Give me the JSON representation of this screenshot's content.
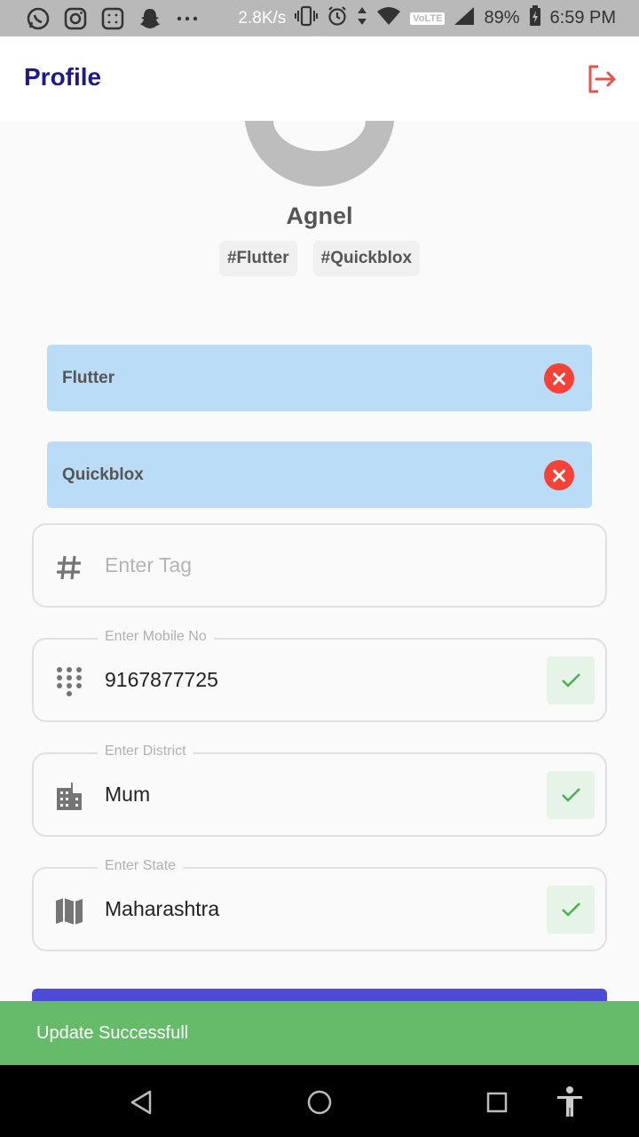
{
  "status_bar": {
    "speed": "2.8K/s",
    "network": "VoLTE",
    "battery": "89%",
    "time": "6:59 PM",
    "icons": [
      "whatsapp-icon",
      "instagram-icon",
      "calculator-icon",
      "snapchat-icon",
      "more-dots-icon",
      "vibrate-icon",
      "alarm-icon",
      "data-arrows-icon",
      "wifi-icon",
      "signal-icon",
      "battery-icon"
    ]
  },
  "appbar": {
    "title": "Profile",
    "logout_icon": "logout-icon",
    "logout_color": "#e5534b"
  },
  "profile": {
    "name": "Agnel",
    "hashtags": [
      "#Flutter",
      "#Quickblox"
    ]
  },
  "tags": [
    {
      "label": "Flutter"
    },
    {
      "label": "Quickblox"
    }
  ],
  "tag_input": {
    "placeholder": "Enter Tag",
    "icon": "hashtag-icon"
  },
  "fields": {
    "mobile": {
      "legend": "Enter Mobile No",
      "value": "9167877725",
      "icon": "dialpad-icon"
    },
    "district": {
      "legend": "Enter District",
      "value": "Mum",
      "icon": "building-icon"
    },
    "state": {
      "legend": "Enter State",
      "value": "Maharashtra",
      "icon": "map-icon"
    }
  },
  "snackbar": {
    "message": "Update Successfull",
    "color": "#66bb6a"
  },
  "colors": {
    "accent": "#1f1a8a",
    "tag_bg": "#bbdcf7",
    "remove": "#f44336",
    "button": "#4d4bd8"
  }
}
